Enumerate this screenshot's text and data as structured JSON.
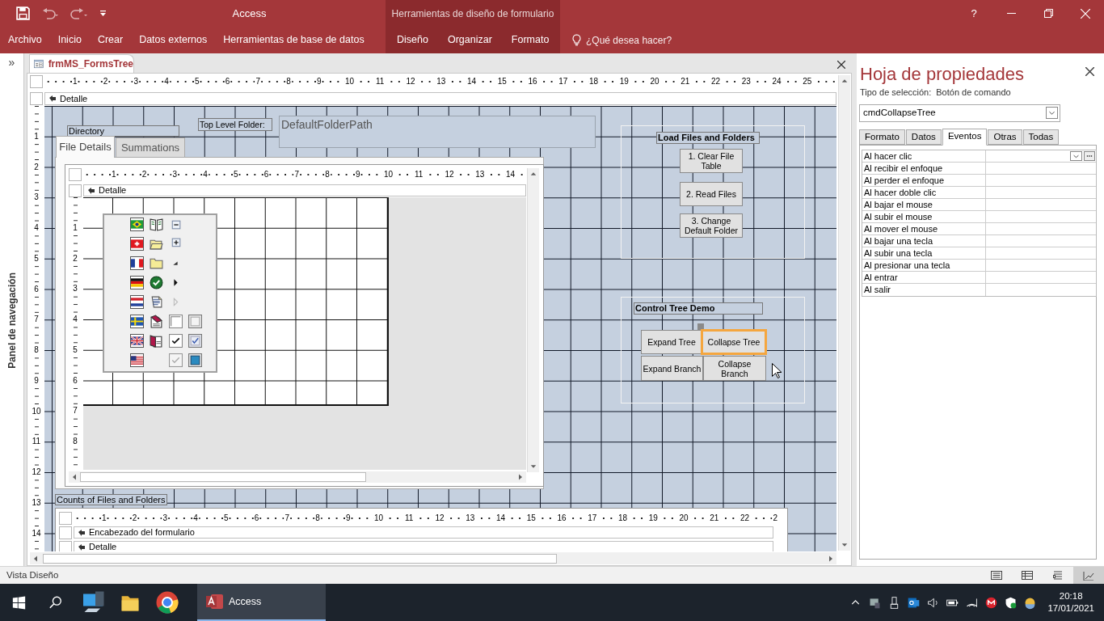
{
  "title_bar": {
    "title": "Access",
    "context_group": "Herramientas de diseño de formulario",
    "help": "?"
  },
  "ribbon_tabs": [
    {
      "label": "Archivo",
      "contextual": false
    },
    {
      "label": "Inicio",
      "contextual": false
    },
    {
      "label": "Crear",
      "contextual": false
    },
    {
      "label": "Datos externos",
      "contextual": false
    },
    {
      "label": "Herramientas de base de datos",
      "contextual": false
    },
    {
      "label": "Diseño",
      "contextual": true
    },
    {
      "label": "Organizar",
      "contextual": true
    },
    {
      "label": "Formato",
      "contextual": true
    }
  ],
  "tell_me": "¿Qué desea hacer?",
  "navigation_pane": {
    "toggle": "»",
    "label": "Panel de navegación"
  },
  "document": {
    "tab": "frmMS_FormsTree",
    "top_ruler": [
      "1",
      "2",
      "3",
      "4",
      "5",
      "6",
      "7",
      "8",
      "9",
      "10",
      "11",
      "12",
      "13",
      "14",
      "15",
      "16",
      "17",
      "18",
      "19",
      "20",
      "21",
      "22",
      "23",
      "24",
      "25"
    ],
    "left_ruler": [
      "1",
      "2",
      "3",
      "4",
      "5",
      "6",
      "7",
      "8",
      "9",
      "10",
      "11",
      "12",
      "13",
      "14"
    ],
    "section": "Detalle",
    "form": {
      "directory_label": "Directory",
      "top_level_label": "Top Level Folder:",
      "folder_path_box": "DefaultFolderPath",
      "tabs": [
        {
          "label": "File Details",
          "selected": true
        },
        {
          "label": "Summations",
          "selected": false
        }
      ],
      "subform": {
        "top_ruler": [
          "1",
          "2",
          "3",
          "4",
          "5",
          "6",
          "7",
          "8",
          "9",
          "10",
          "11",
          "12",
          "13",
          "14"
        ],
        "left_ruler": [
          "1",
          "2",
          "3",
          "4",
          "5",
          "6",
          "7",
          "8"
        ],
        "section": "Detalle"
      },
      "counts_label": "Counts of Files and Folders",
      "counts_subform": {
        "top_ruler": [
          "1",
          "2",
          "3",
          "4",
          "5",
          "6",
          "7",
          "8",
          "9",
          "10",
          "11",
          "12",
          "13",
          "14",
          "15",
          "16",
          "17",
          "18",
          "19",
          "20",
          "21",
          "22",
          "2"
        ],
        "sections": [
          "Encabezado del formulario",
          "Detalle"
        ]
      },
      "frames": [
        {
          "title": "Load Files and Folders",
          "buttons": [
            {
              "label": "1. Clear File Table",
              "selected": false
            },
            {
              "label": "2. Read Files",
              "selected": false
            },
            {
              "label": "3. Change Default Folder",
              "selected": false
            }
          ]
        },
        {
          "title": "Control Tree Demo",
          "buttons": [
            {
              "label": "Expand Tree",
              "selected": false
            },
            {
              "label": "Collapse Tree",
              "selected": true
            },
            {
              "label": "Expand Branch",
              "selected": false
            },
            {
              "label": "Collapse Branch",
              "selected": false
            }
          ]
        }
      ]
    }
  },
  "property_sheet": {
    "title": "Hoja de propiedades",
    "selection_type_label": "Tipo de selección:",
    "selection_type": "Botón de comando",
    "object": "cmdCollapseTree",
    "tabs": [
      {
        "label": "Formato",
        "selected": false
      },
      {
        "label": "Datos",
        "selected": false
      },
      {
        "label": "Eventos",
        "selected": true
      },
      {
        "label": "Otras",
        "selected": false
      },
      {
        "label": "Todas",
        "selected": false
      }
    ],
    "events": [
      "Al hacer clic",
      "Al recibir el enfoque",
      "Al perder el enfoque",
      "Al hacer doble clic",
      "Al bajar el mouse",
      "Al subir el mouse",
      "Al mover el mouse",
      "Al bajar una tecla",
      "Al subir una tecla",
      "Al presionar una tecla",
      "Al entrar",
      "Al salir"
    ]
  },
  "status_bar": {
    "view": "Vista Diseño"
  },
  "taskbar": {
    "app": "Access",
    "time": "20:18",
    "date": "17/01/2021"
  }
}
